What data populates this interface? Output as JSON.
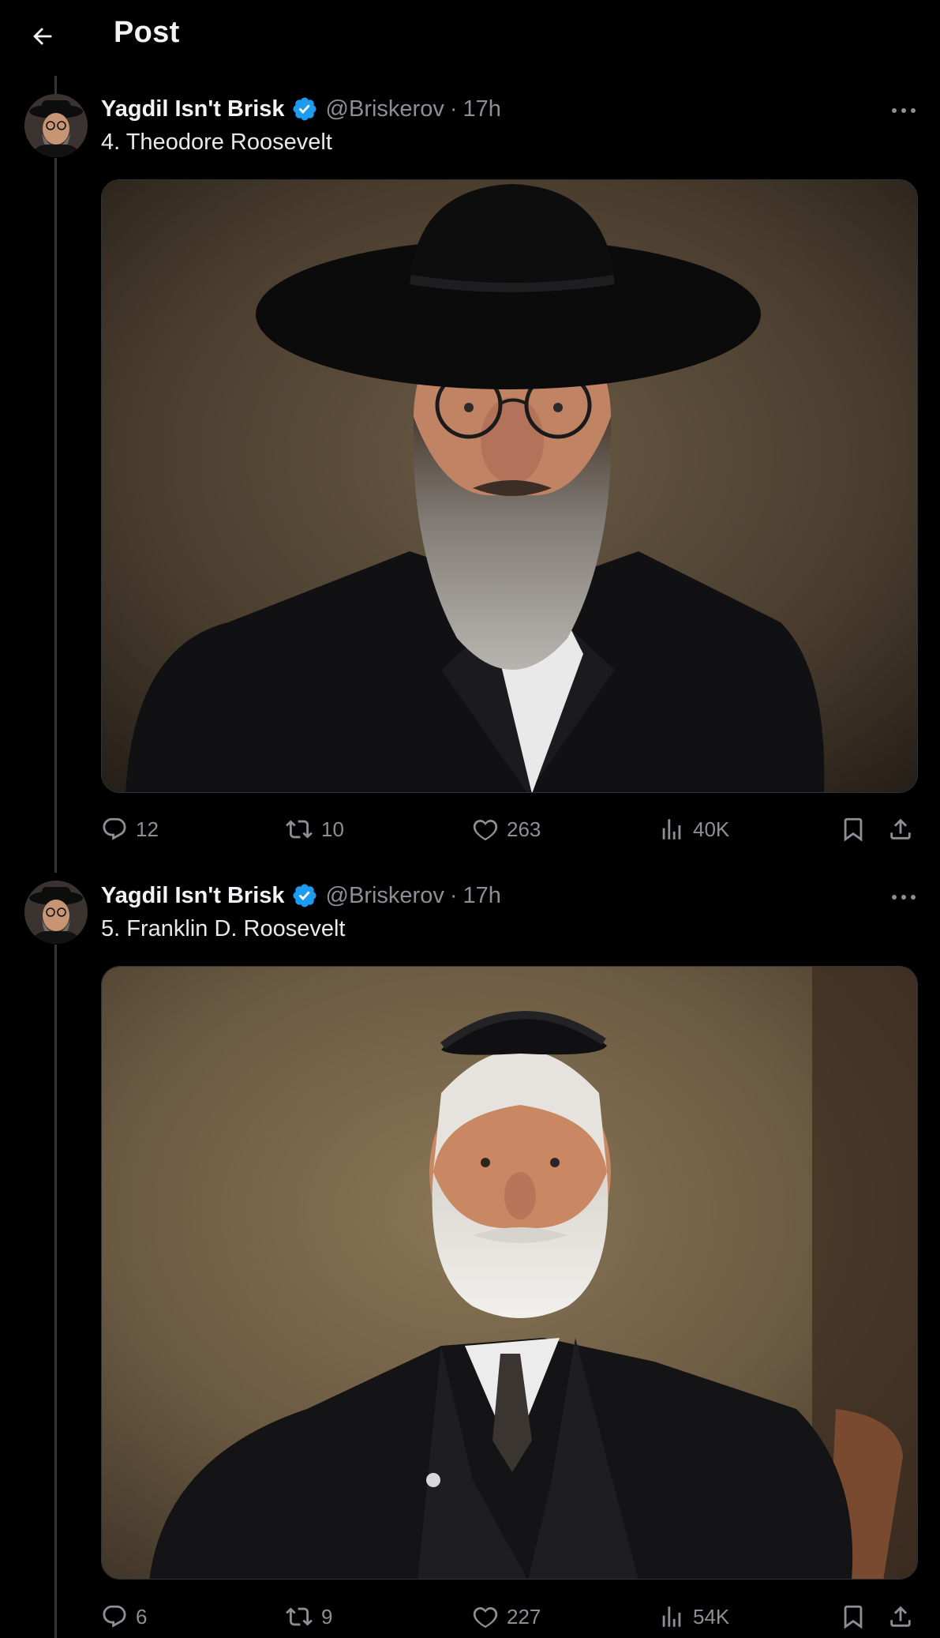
{
  "header": {
    "title": "Post",
    "back_icon": "arrow-left-icon"
  },
  "colors": {
    "background": "#000000",
    "text_primary": "#e7e9ea",
    "text_secondary": "#8b9096",
    "verified_blue": "#1d9bf0",
    "thread_line": "#333639"
  },
  "posts": [
    {
      "author": "Yagdil Isn't Brisk",
      "verified": true,
      "handle": "@Briskerov",
      "separator": "·",
      "time": "17h",
      "text": "4. Theodore Roosevelt",
      "media_icon": "portrait-image",
      "stats": {
        "replies": "12",
        "reposts": "10",
        "likes": "263",
        "views": "40K"
      }
    },
    {
      "author": "Yagdil Isn't Brisk",
      "verified": true,
      "handle": "@Briskerov",
      "separator": "·",
      "time": "17h",
      "text": "5. Franklin D. Roosevelt",
      "media_icon": "portrait-image",
      "stats": {
        "replies": "6",
        "reposts": "9",
        "likes": "227",
        "views": "54K"
      }
    }
  ]
}
